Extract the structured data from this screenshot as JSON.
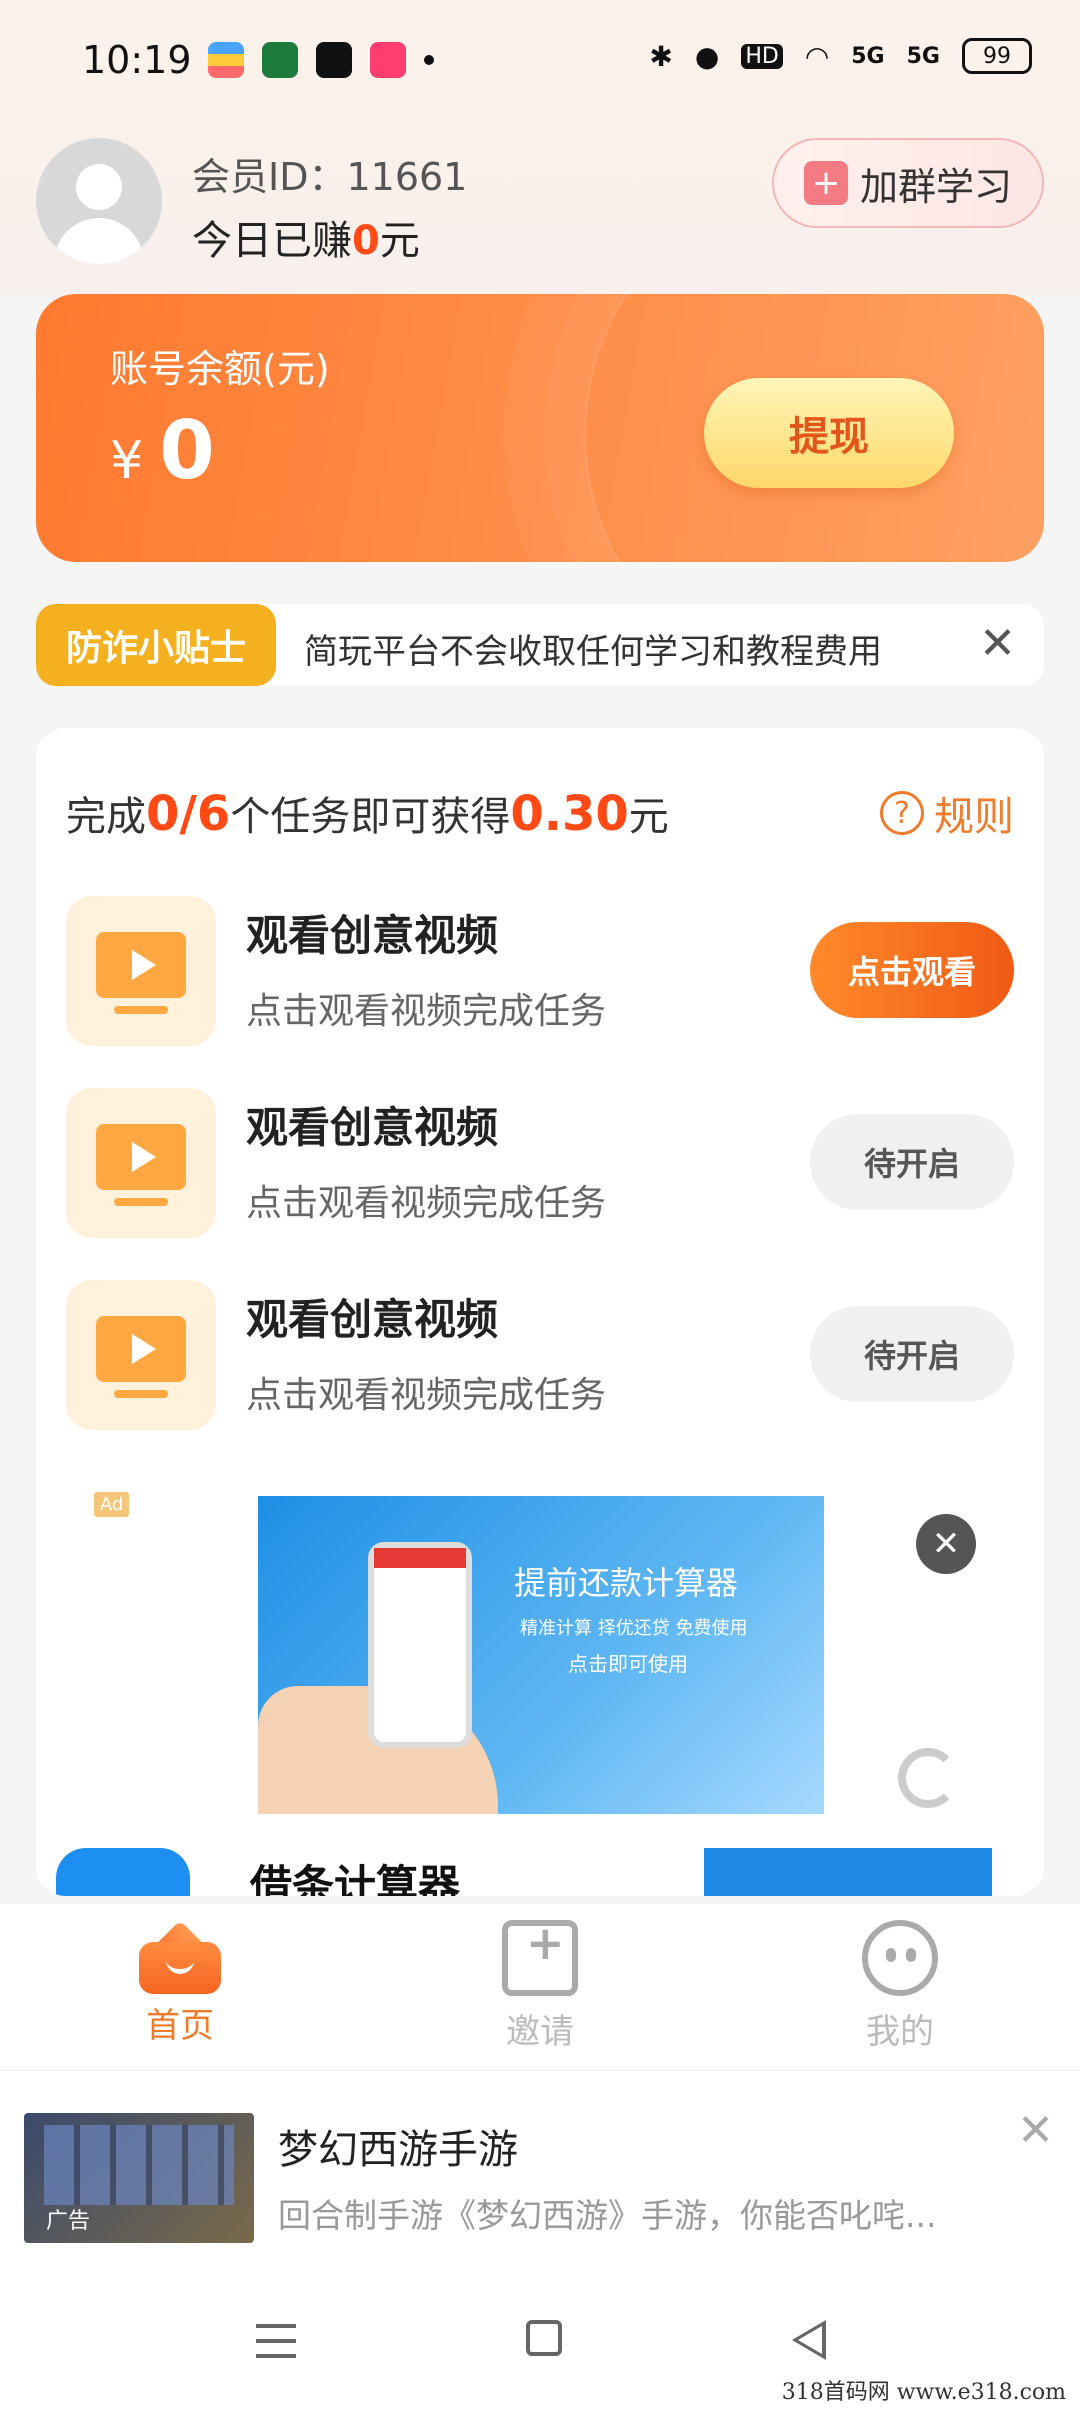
{
  "status_bar": {
    "time": "10:19",
    "hd": "HD",
    "net1": "5G",
    "net2": "5G",
    "battery": "99"
  },
  "header": {
    "member_id": "会员ID：11661",
    "earned_prefix": "今日已赚",
    "earned_value": "0",
    "earned_suffix": "元",
    "join_group_label": "加群学习"
  },
  "balance": {
    "label": "账号余额(元)",
    "currency": "¥",
    "value": "0",
    "withdraw_label": "提现"
  },
  "tips": {
    "tag": "防诈小贴士",
    "text": "简玩平台不会收取任何学习和教程费用",
    "close": "✕"
  },
  "tasks": {
    "title_prefix": "完成",
    "progress": "0/6",
    "title_middle": "个任务即可获得",
    "reward": "0.30",
    "title_suffix": "元",
    "rules_label": "规则",
    "items": [
      {
        "name": "观看创意视频",
        "desc": "点击观看视频完成任务",
        "button": "点击观看",
        "state": "active"
      },
      {
        "name": "观看创意视频",
        "desc": "点击观看视频完成任务",
        "button": "待开启",
        "state": "wait"
      },
      {
        "name": "观看创意视频",
        "desc": "点击观看视频完成任务",
        "button": "待开启",
        "state": "wait"
      }
    ]
  },
  "ad": {
    "tag": "Ad",
    "headline": "提前还款计算器",
    "subline": "精准计算 择优还贷 免费使用",
    "cta": "点击即可使用",
    "app_name": "借条计算器"
  },
  "nav": {
    "items": [
      {
        "label": "首页",
        "icon": "home-icon",
        "active": true
      },
      {
        "label": "邀请",
        "icon": "invite-icon",
        "active": false
      },
      {
        "label": "我的",
        "icon": "profile-icon",
        "active": false
      }
    ]
  },
  "bottom_ad": {
    "label": "广告",
    "title": "梦幻西游手游",
    "desc": "回合制手游《梦幻西游》手游，你能否叱咤...",
    "close": "✕"
  },
  "watermark": "318首码网  www.e318.com",
  "colors": {
    "accent": "#f07b2b",
    "highlight": "#ff4a16",
    "tip_tag": "#f4b01e"
  }
}
